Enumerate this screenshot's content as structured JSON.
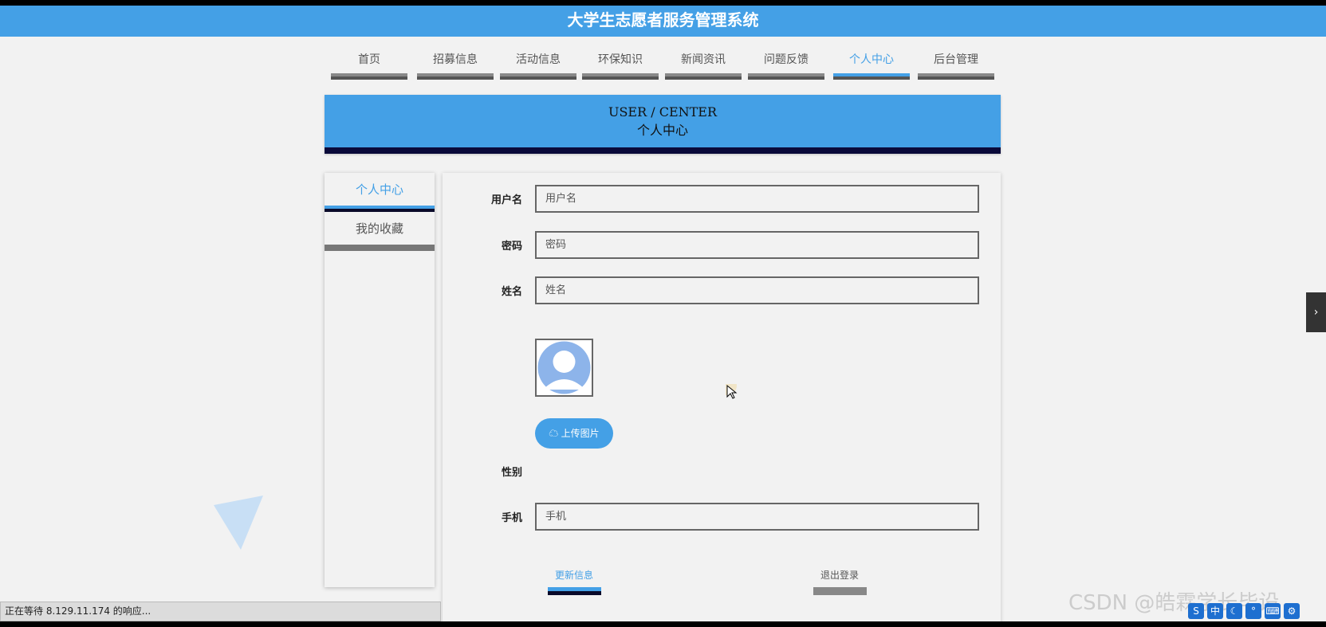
{
  "app": {
    "title": "大学生志愿者服务管理系统"
  },
  "nav": {
    "items": [
      {
        "label": "首页"
      },
      {
        "label": "招募信息"
      },
      {
        "label": "活动信息"
      },
      {
        "label": "环保知识"
      },
      {
        "label": "新闻资讯"
      },
      {
        "label": "问题反馈"
      },
      {
        "label": "个人中心",
        "active": true
      },
      {
        "label": "后台管理"
      }
    ]
  },
  "banner": {
    "en": "USER / CENTER",
    "cn": "个人中心"
  },
  "sidebar": {
    "items": [
      {
        "label": "个人中心",
        "active": true
      },
      {
        "label": "我的收藏"
      }
    ]
  },
  "form": {
    "username": {
      "label": "用户名",
      "placeholder": "用户名"
    },
    "password": {
      "label": "密码",
      "placeholder": "密码"
    },
    "name": {
      "label": "姓名",
      "placeholder": "姓名"
    },
    "upload_label": "上传图片",
    "gender": {
      "label": "性别"
    },
    "phone": {
      "label": "手机",
      "placeholder": "手机"
    },
    "update_label": "更新信息",
    "logout_label": "退出登录"
  },
  "statusbar": {
    "text": "正在等待 8.129.11.174 的响应..."
  },
  "watermark": "CSDN @皓霖学长毕设",
  "colors": {
    "accent": "#44a0e6",
    "background": "#f2f2f2",
    "dark_bar": "#0a0a3a"
  }
}
